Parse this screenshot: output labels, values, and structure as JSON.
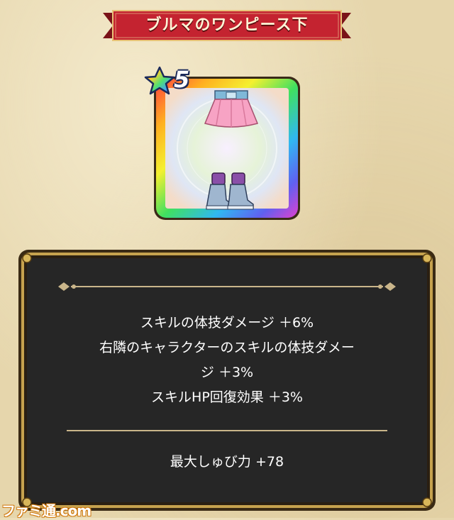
{
  "title": "ブルマのワンピース下",
  "item": {
    "star_rarity": "5",
    "image_description_icon": "skirt-and-boots-icon",
    "frame_style": "rainbow"
  },
  "effects": [
    "スキルの体技ダメージ ＋6%",
    "右隣のキャラクターのスキルの体技ダメー",
    "ジ ＋3%",
    "スキルHP回復効果 ＋3%"
  ],
  "stat": "最大しゅび力 +78",
  "watermark": "ファミ通.com",
  "colors": {
    "ribbon": "#b31f2a",
    "panel": "#262626",
    "panel_border": "#c8a44c",
    "background": "#e6d6ac"
  }
}
